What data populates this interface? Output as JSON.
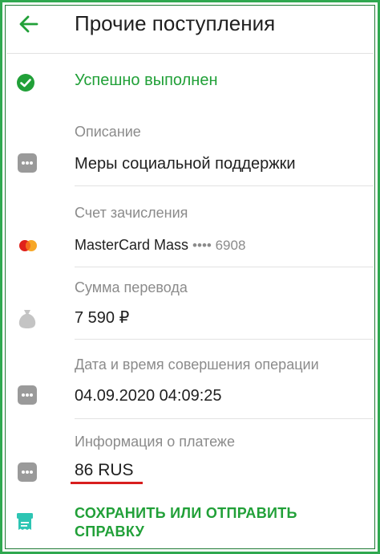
{
  "header": {
    "title": "Прочие поступления",
    "back_icon": "arrow-left-icon"
  },
  "status": {
    "text": "Успешно выполнен",
    "icon": "check-circle-icon",
    "color": "#21a038"
  },
  "details": {
    "description": {
      "label": "Описание",
      "value": "Меры социальной поддержки",
      "icon": "more-dots-icon"
    },
    "account": {
      "label": "Счет зачисления",
      "card_name": "MasterCard Mass",
      "masked_number": "•••• 6908",
      "icon": "mastercard-icon"
    },
    "amount": {
      "label": "Сумма перевода",
      "value": "7 590 ₽",
      "icon": "money-bag-icon"
    },
    "datetime": {
      "label": "Дата и время совершения операции",
      "value": "04.09.2020 04:09:25",
      "icon": "more-dots-icon"
    },
    "payment_info": {
      "label": "Информация о платеже",
      "value": "86 RUS",
      "icon": "more-dots-icon"
    }
  },
  "action": {
    "save_label": "СОХРАНИТЬ ИЛИ ОТПРАВИТЬ СПРАВКУ",
    "icon": "receipt-icon"
  },
  "colors": {
    "accent": "#21a038",
    "frame": "#2fa84f",
    "highlight_underline": "#d81e1e"
  }
}
